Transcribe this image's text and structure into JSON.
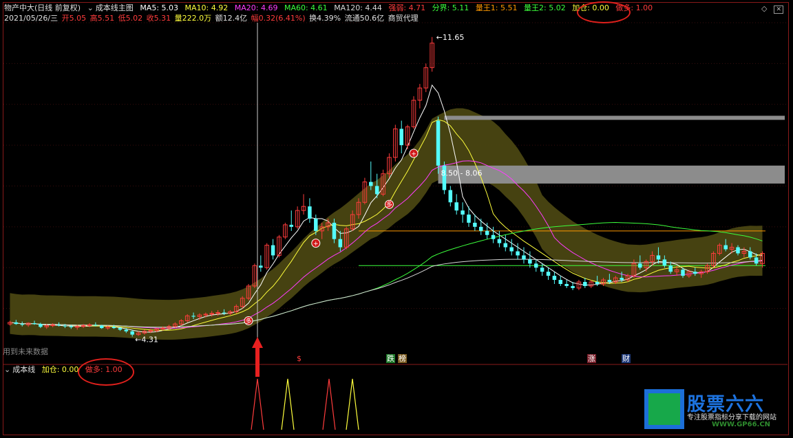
{
  "header": {
    "stock": "物产中大(日线 前复权)",
    "indicator": "成本线主图",
    "ma5": "MA5: 5.03",
    "ma10": "MA10: 4.92",
    "ma20": "MA20: 4.69",
    "ma60": "MA60: 4.61",
    "ma120": "MA120: 4.44",
    "strength": "强弱: 4.71",
    "boundary": "分界: 5.11",
    "king1": "量王1: 5.51",
    "king2": "量王2: 5.02",
    "add_pos": "加仓: 0.00",
    "long": "做多: 1.00",
    "date": "2021/05/26/三",
    "open": "开5.05",
    "high": "高5.51",
    "low": "低5.02",
    "close": "收5.31",
    "volume": "量222.0万",
    "amount": "额12.4亿",
    "amplitude": "幅0.32(6.41%)",
    "turnover": "换4.39%",
    "float": "流通50.6亿",
    "sector": "商贸代理"
  },
  "sub": {
    "title": "成本线",
    "add_pos": "加仓: 0.00",
    "long": "做多: 1.00"
  },
  "future_label": "用到未来数据",
  "events": [
    "$",
    "跌",
    "榜",
    "涨",
    "财"
  ],
  "markers": {
    "duo": "多",
    "plus": "+"
  },
  "annotations": {
    "max_price": "11.65",
    "min_price": "4.31",
    "band_label": "8.50 - 8.06"
  },
  "icons": [
    "diamond-icon",
    "close-icon"
  ],
  "watermark": {
    "title": "股票六六",
    "subtitle": "专注股票指标分享下载的网站",
    "url": "WWW.GP66.CN"
  },
  "colors": {
    "up": "#ff3c3c",
    "down": "#54fcfc",
    "ma5": "#ffffff",
    "ma10": "#ffff3c",
    "ma20": "#ff3cff",
    "ma60": "#3cff3c",
    "ma120": "#d8d8d8",
    "cloud": "#4a4612",
    "gray_band": "#8c8c8c",
    "long_circle": "#e0201c"
  },
  "chart_data": {
    "type": "candlestick",
    "price_range": [
      4.0,
      12.0
    ],
    "ohlc": [
      [
        4.62,
        4.7,
        4.58,
        4.66
      ],
      [
        4.66,
        4.72,
        4.6,
        4.62
      ],
      [
        4.62,
        4.68,
        4.56,
        4.6
      ],
      [
        4.6,
        4.66,
        4.55,
        4.64
      ],
      [
        4.64,
        4.7,
        4.6,
        4.62
      ],
      [
        4.62,
        4.65,
        4.52,
        4.55
      ],
      [
        4.55,
        4.62,
        4.5,
        4.58
      ],
      [
        4.58,
        4.64,
        4.54,
        4.6
      ],
      [
        4.6,
        4.66,
        4.56,
        4.58
      ],
      [
        4.58,
        4.62,
        4.52,
        4.56
      ],
      [
        4.56,
        4.6,
        4.5,
        4.54
      ],
      [
        4.54,
        4.6,
        4.48,
        4.56
      ],
      [
        4.56,
        4.62,
        4.52,
        4.58
      ],
      [
        4.58,
        4.64,
        4.54,
        4.6
      ],
      [
        4.6,
        4.66,
        4.56,
        4.58
      ],
      [
        4.58,
        4.6,
        4.5,
        4.52
      ],
      [
        4.52,
        4.58,
        4.48,
        4.55
      ],
      [
        4.55,
        4.6,
        4.5,
        4.52
      ],
      [
        4.52,
        4.55,
        4.45,
        4.48
      ],
      [
        4.48,
        4.52,
        4.4,
        4.44
      ],
      [
        4.44,
        4.48,
        4.31,
        4.36
      ],
      [
        4.36,
        4.44,
        4.33,
        4.4
      ],
      [
        4.4,
        4.48,
        4.36,
        4.44
      ],
      [
        4.44,
        4.5,
        4.4,
        4.46
      ],
      [
        4.46,
        4.52,
        4.42,
        4.5
      ],
      [
        4.5,
        4.56,
        4.46,
        4.52
      ],
      [
        4.52,
        4.6,
        4.48,
        4.56
      ],
      [
        4.56,
        4.66,
        4.52,
        4.62
      ],
      [
        4.62,
        4.74,
        4.58,
        4.7
      ],
      [
        4.7,
        4.86,
        4.66,
        4.82
      ],
      [
        4.82,
        4.9,
        4.74,
        4.8
      ],
      [
        4.8,
        4.88,
        4.72,
        4.84
      ],
      [
        4.84,
        4.9,
        4.78,
        4.86
      ],
      [
        4.86,
        4.94,
        4.8,
        4.88
      ],
      [
        4.88,
        4.96,
        4.82,
        4.9
      ],
      [
        4.9,
        4.98,
        4.84,
        4.88
      ],
      [
        4.88,
        4.96,
        4.84,
        4.92
      ],
      [
        4.92,
        5.1,
        4.88,
        5.05
      ],
      [
        5.05,
        5.3,
        5.0,
        5.25
      ],
      [
        5.25,
        5.6,
        5.2,
        5.55
      ],
      [
        5.55,
        6.1,
        5.5,
        6.05
      ],
      [
        6.05,
        6.3,
        5.9,
        6.0
      ],
      [
        6.0,
        6.6,
        5.95,
        6.55
      ],
      [
        6.55,
        6.7,
        6.2,
        6.3
      ],
      [
        6.3,
        6.8,
        6.25,
        6.75
      ],
      [
        6.75,
        7.1,
        6.7,
        7.05
      ],
      [
        7.05,
        7.4,
        6.9,
        7.0
      ],
      [
        7.0,
        7.5,
        6.95,
        7.4
      ],
      [
        7.4,
        7.8,
        7.3,
        7.5
      ],
      [
        7.5,
        7.7,
        7.1,
        7.2
      ],
      [
        7.2,
        7.3,
        6.8,
        6.9
      ],
      [
        6.9,
        7.1,
        6.7,
        7.0
      ],
      [
        7.0,
        7.2,
        6.9,
        7.1
      ],
      [
        7.1,
        7.2,
        6.6,
        6.7
      ],
      [
        6.7,
        6.9,
        6.4,
        6.5
      ],
      [
        6.5,
        7.0,
        6.45,
        6.95
      ],
      [
        6.95,
        7.4,
        6.9,
        7.3
      ],
      [
        7.3,
        7.7,
        7.2,
        7.6
      ],
      [
        7.6,
        8.2,
        7.55,
        8.1
      ],
      [
        8.1,
        8.6,
        7.9,
        8.0
      ],
      [
        8.0,
        8.3,
        7.7,
        7.8
      ],
      [
        7.8,
        8.4,
        7.75,
        8.3
      ],
      [
        8.3,
        8.8,
        8.2,
        8.7
      ],
      [
        8.7,
        9.5,
        8.6,
        9.4
      ],
      [
        9.4,
        9.6,
        8.8,
        9.0
      ],
      [
        9.0,
        9.5,
        8.9,
        9.45
      ],
      [
        9.45,
        10.2,
        9.4,
        10.1
      ],
      [
        10.1,
        10.5,
        9.9,
        10.4
      ],
      [
        10.4,
        11.0,
        10.3,
        10.9
      ],
      [
        10.9,
        11.65,
        10.8,
        11.5
      ],
      [
        9.6,
        9.7,
        8.3,
        8.5
      ],
      [
        8.5,
        8.6,
        7.8,
        7.9
      ],
      [
        7.9,
        8.0,
        7.5,
        7.6
      ],
      [
        7.6,
        7.8,
        7.3,
        7.4
      ],
      [
        7.4,
        7.6,
        7.1,
        7.3
      ],
      [
        7.3,
        7.5,
        7.0,
        7.1
      ],
      [
        7.1,
        7.3,
        6.9,
        7.0
      ],
      [
        7.0,
        7.2,
        6.8,
        6.9
      ],
      [
        6.9,
        7.1,
        6.7,
        6.8
      ],
      [
        6.8,
        7.0,
        6.6,
        6.7
      ],
      [
        6.7,
        6.9,
        6.5,
        6.6
      ],
      [
        6.6,
        6.8,
        6.4,
        6.5
      ],
      [
        6.5,
        6.7,
        6.3,
        6.4
      ],
      [
        6.4,
        6.6,
        6.2,
        6.3
      ],
      [
        6.3,
        6.5,
        6.1,
        6.2
      ],
      [
        6.2,
        6.4,
        6.0,
        6.1
      ],
      [
        6.1,
        6.2,
        5.9,
        6.0
      ],
      [
        6.0,
        6.1,
        5.8,
        5.9
      ],
      [
        5.9,
        6.0,
        5.7,
        5.8
      ],
      [
        5.8,
        5.9,
        5.6,
        5.7
      ],
      [
        5.7,
        5.8,
        5.55,
        5.6
      ],
      [
        5.6,
        5.7,
        5.5,
        5.55
      ],
      [
        5.55,
        5.65,
        5.45,
        5.5
      ],
      [
        5.5,
        5.7,
        5.45,
        5.65
      ],
      [
        5.65,
        5.75,
        5.5,
        5.55
      ],
      [
        5.55,
        5.7,
        5.5,
        5.65
      ],
      [
        5.65,
        5.8,
        5.55,
        5.6
      ],
      [
        5.6,
        5.75,
        5.55,
        5.7
      ],
      [
        5.7,
        5.85,
        5.6,
        5.65
      ],
      [
        5.65,
        5.8,
        5.6,
        5.75
      ],
      [
        5.75,
        5.9,
        5.65,
        5.7
      ],
      [
        5.7,
        5.85,
        5.65,
        5.8
      ],
      [
        5.8,
        6.2,
        5.75,
        6.1
      ],
      [
        6.1,
        6.3,
        5.95,
        6.0
      ],
      [
        6.0,
        6.2,
        5.9,
        6.15
      ],
      [
        6.15,
        6.4,
        6.05,
        6.3
      ],
      [
        6.3,
        6.5,
        6.1,
        6.2
      ],
      [
        6.2,
        6.3,
        6.0,
        6.05
      ],
      [
        6.05,
        6.15,
        5.85,
        5.9
      ],
      [
        5.9,
        6.05,
        5.8,
        5.95
      ],
      [
        5.95,
        6.0,
        5.75,
        5.8
      ],
      [
        5.8,
        5.95,
        5.75,
        5.9
      ],
      [
        5.9,
        6.0,
        5.8,
        5.85
      ],
      [
        5.85,
        5.95,
        5.75,
        5.9
      ],
      [
        5.9,
        6.1,
        5.85,
        6.05
      ],
      [
        6.05,
        6.4,
        6.0,
        6.35
      ],
      [
        6.35,
        6.6,
        6.3,
        6.55
      ],
      [
        6.55,
        6.7,
        6.4,
        6.45
      ],
      [
        6.45,
        6.6,
        6.35,
        6.5
      ],
      [
        6.5,
        6.55,
        6.3,
        6.35
      ],
      [
        6.35,
        6.5,
        6.25,
        6.4
      ],
      [
        6.4,
        6.5,
        6.2,
        6.25
      ],
      [
        6.25,
        6.35,
        6.05,
        6.1
      ],
      [
        6.1,
        6.4,
        6.0,
        6.35
      ]
    ]
  }
}
